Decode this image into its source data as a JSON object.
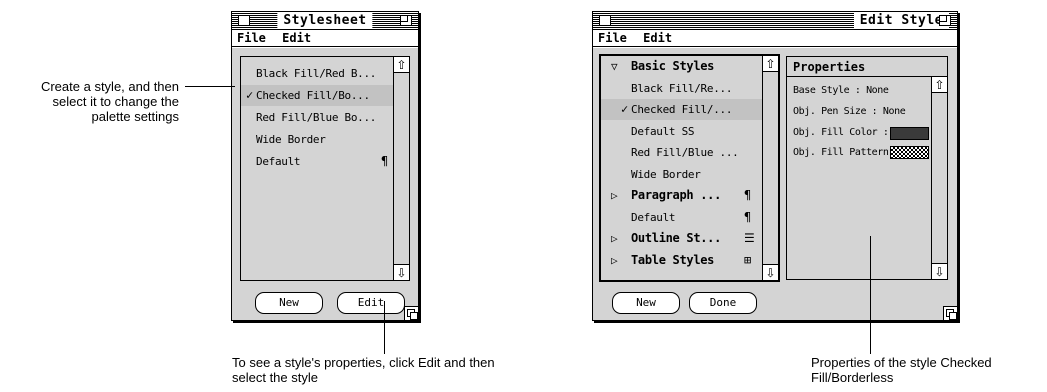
{
  "stylesheet_window": {
    "title": "Stylesheet",
    "menu": [
      "File",
      "Edit"
    ],
    "items": [
      {
        "label": "Black Fill/Red B...",
        "checked": false,
        "icon": ""
      },
      {
        "label": "Checked Fill/Bo...",
        "checked": true,
        "icon": ""
      },
      {
        "label": "Red Fill/Blue Bo...",
        "checked": false,
        "icon": ""
      },
      {
        "label": "Wide Border",
        "checked": false,
        "icon": ""
      },
      {
        "label": "Default",
        "checked": false,
        "icon": "¶"
      }
    ],
    "check_mark": "✓",
    "buttons": {
      "new": "New",
      "edit": "Edit"
    }
  },
  "edit_style_window": {
    "title": "Edit Style",
    "menu": [
      "File",
      "Edit"
    ],
    "tree": [
      {
        "label": "Basic Styles",
        "group": true,
        "expanded": true,
        "triangle": "▽",
        "icon": ""
      },
      {
        "label": "Black Fill/Re...",
        "group": false,
        "checked": false,
        "icon": ""
      },
      {
        "label": "Checked Fill/...",
        "group": false,
        "checked": true,
        "icon": ""
      },
      {
        "label": "Default SS",
        "group": false,
        "checked": false,
        "icon": ""
      },
      {
        "label": "Red Fill/Blue ...",
        "group": false,
        "checked": false,
        "icon": ""
      },
      {
        "label": "Wide Border",
        "group": false,
        "checked": false,
        "icon": ""
      },
      {
        "label": "Paragraph ...",
        "group": true,
        "expanded": false,
        "triangle": "▷",
        "icon": "¶"
      },
      {
        "label": "Default",
        "group": false,
        "checked": false,
        "icon": "¶"
      },
      {
        "label": "Outline St...",
        "group": true,
        "expanded": false,
        "triangle": "▷",
        "icon": "☰"
      },
      {
        "label": "Table Styles",
        "group": true,
        "expanded": false,
        "triangle": "▷",
        "icon": "⊞"
      }
    ],
    "check_mark": "✓",
    "properties": {
      "header": "Properties",
      "base_style": "Base Style : None",
      "pen_size": "Obj. Pen Size : None",
      "fill_color": "Obj. Fill Color :",
      "fill_pattern": "Obj. Fill Pattern :"
    },
    "buttons": {
      "new": "New",
      "done": "Done"
    }
  },
  "callouts": {
    "create_style": "Create a style, and then select it to change the palette settings",
    "see_properties": "To see a style's properties, click Edit and then select the style",
    "properties_of": "Properties of the style Checked Fill/Borderless"
  },
  "icons": {
    "up_arrow": "⇧",
    "down_arrow": "⇩"
  },
  "colors": {
    "panel": "#d4d4d4",
    "selected_row": "#c2c2c2",
    "fill_swatch": "#3a3a3a"
  }
}
